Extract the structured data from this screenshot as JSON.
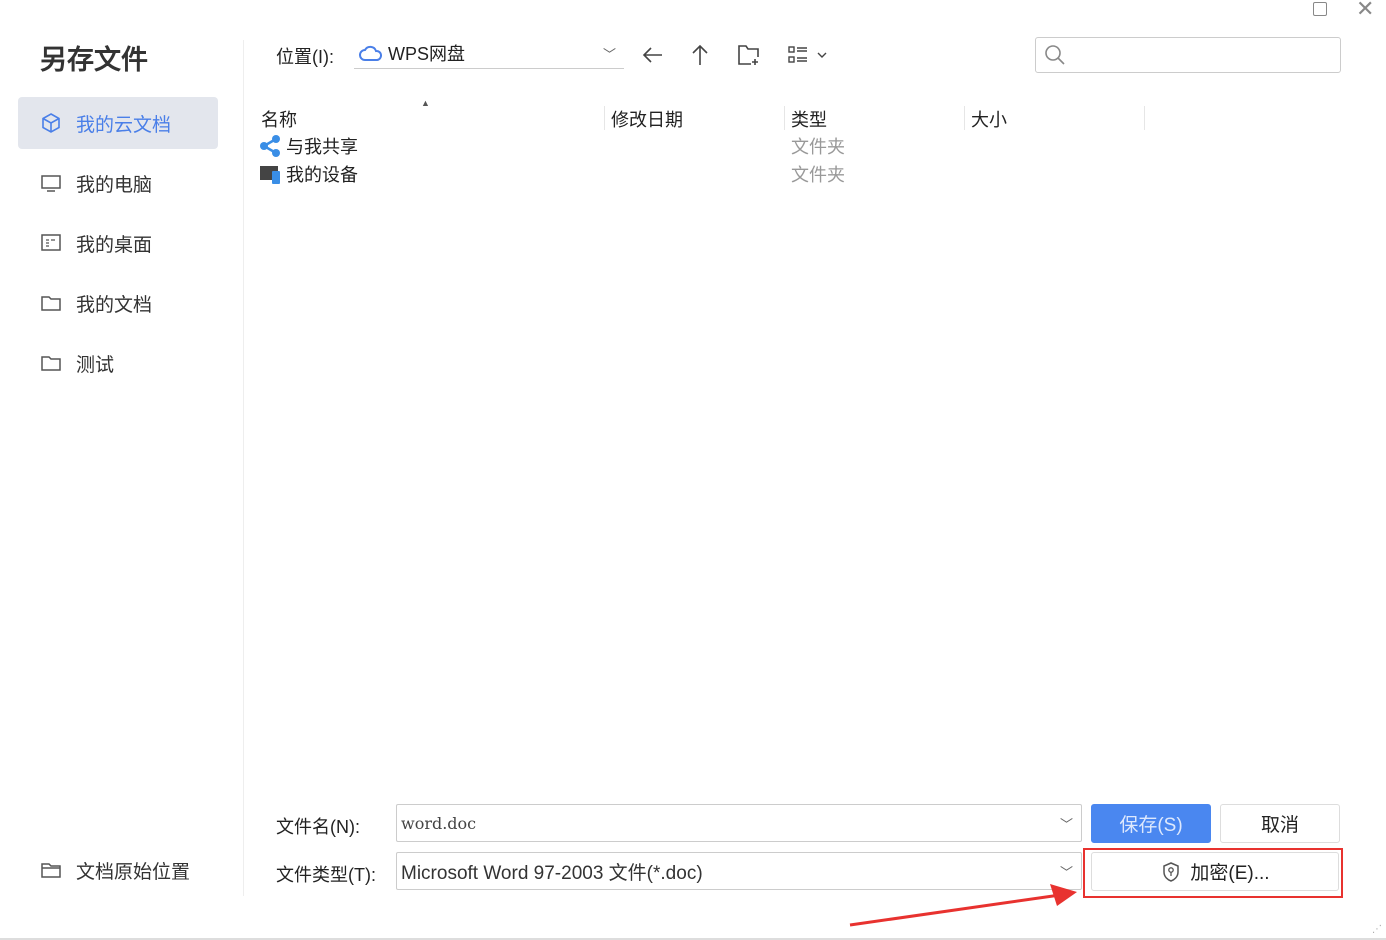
{
  "dialog": {
    "title": "另存文件"
  },
  "window": {
    "maximize": "maximize",
    "close": "close"
  },
  "sidebar": {
    "items": [
      {
        "label": "我的云文档"
      },
      {
        "label": "我的电脑"
      },
      {
        "label": "我的桌面"
      },
      {
        "label": "我的文档"
      },
      {
        "label": "测试"
      }
    ],
    "bottom": "文档原始位置"
  },
  "toolbar": {
    "location_label": "位置(I):",
    "location_value": "WPS网盘",
    "search_placeholder": ""
  },
  "columns": [
    "名称",
    "修改日期",
    "类型",
    "大小"
  ],
  "files": [
    {
      "name": "与我共享",
      "type": "文件夹"
    },
    {
      "name": "我的设备",
      "type": "文件夹"
    }
  ],
  "footer": {
    "filename_label": "文件名(N):",
    "filename_value": "word.doc",
    "filetype_label": "文件类型(T):",
    "filetype_value": "Microsoft Word 97-2003 文件(*.doc)",
    "save": "保存(S)",
    "cancel": "取消",
    "encrypt": "加密(E)..."
  },
  "colors": {
    "accent": "#4a87f0",
    "highlight": "#e8322f"
  }
}
